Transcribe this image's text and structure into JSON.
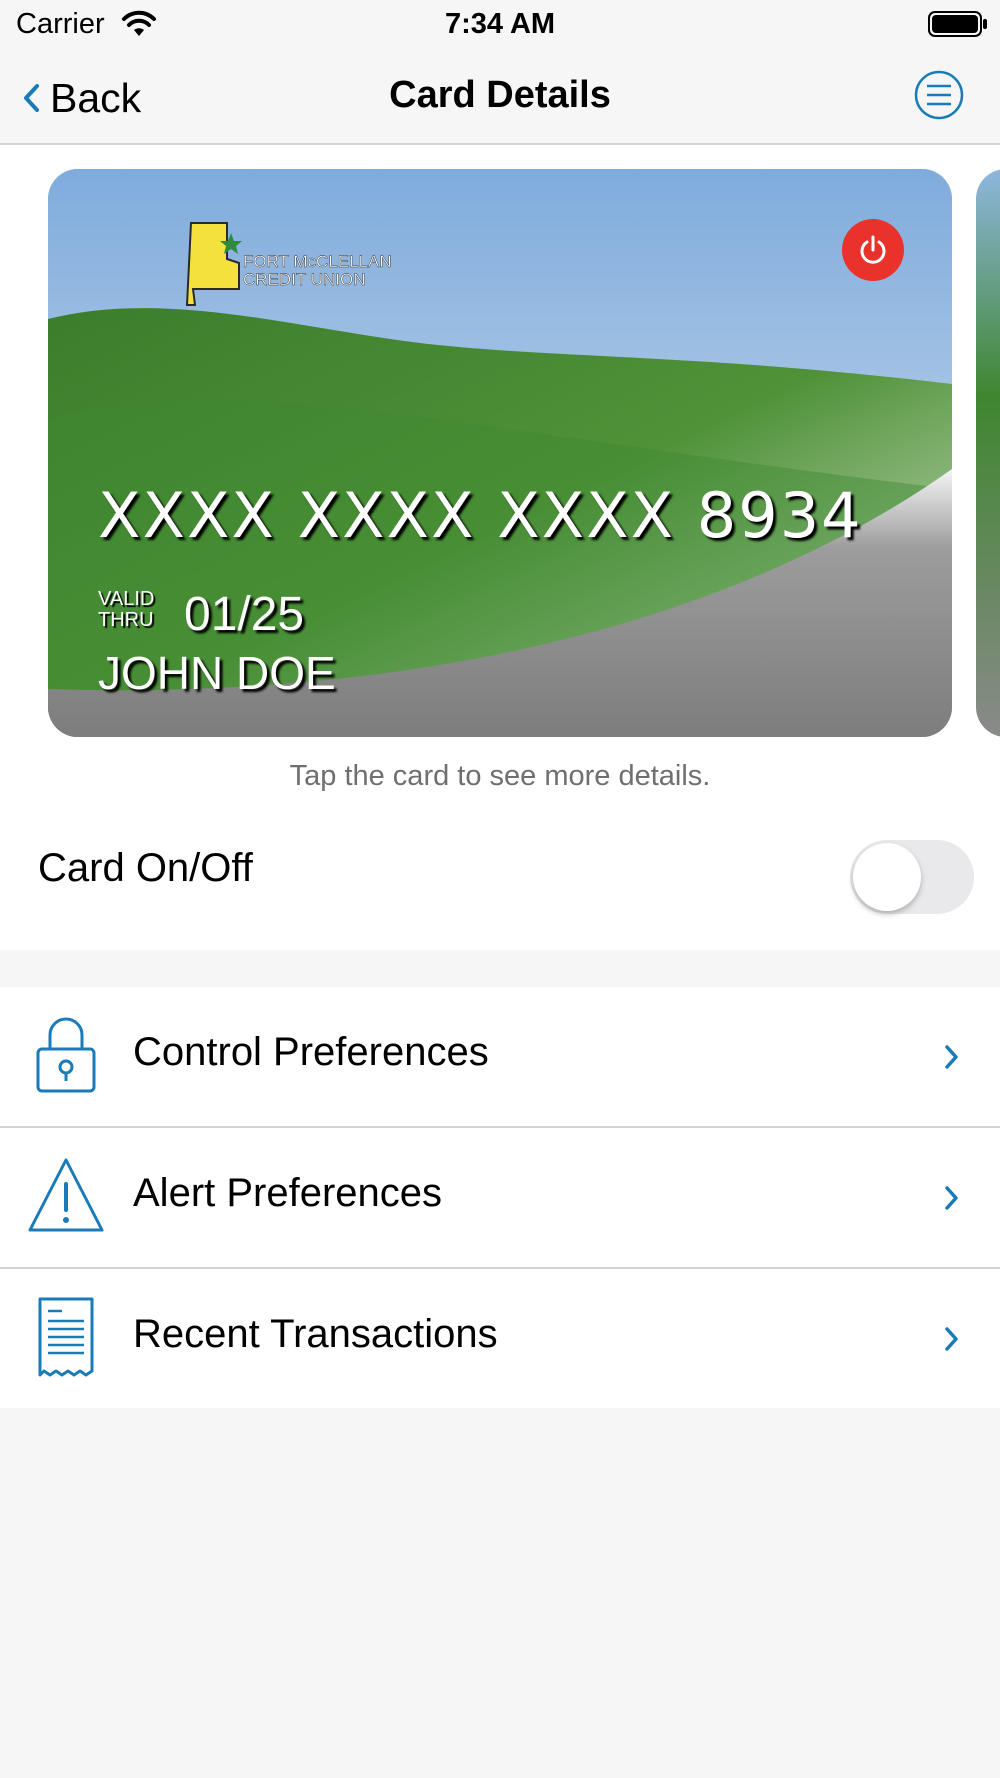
{
  "status_bar": {
    "carrier": "Carrier",
    "time": "7:34 AM"
  },
  "nav": {
    "back_label": "Back",
    "title": "Card Details"
  },
  "card": {
    "bank_name_line1": "FORT McCLELLAN",
    "bank_name_line2": "CREDIT UNION",
    "number": "XXXX XXXX XXXX 8934",
    "valid_label_line1": "VALID",
    "valid_label_line2": "THRU",
    "expiry": "01/25",
    "holder": "JOHN DOE"
  },
  "hint": "Tap the card to see more details.",
  "card_toggle": {
    "label": "Card On/Off",
    "on": false
  },
  "menu": [
    {
      "label": "Control Preferences",
      "icon": "lock-icon"
    },
    {
      "label": "Alert Preferences",
      "icon": "warning-icon"
    },
    {
      "label": "Recent Transactions",
      "icon": "receipt-icon"
    }
  ],
  "colors": {
    "accent": "#1a7bb9",
    "power": "#e8322b",
    "toggle_off": "#e9e9eb"
  }
}
